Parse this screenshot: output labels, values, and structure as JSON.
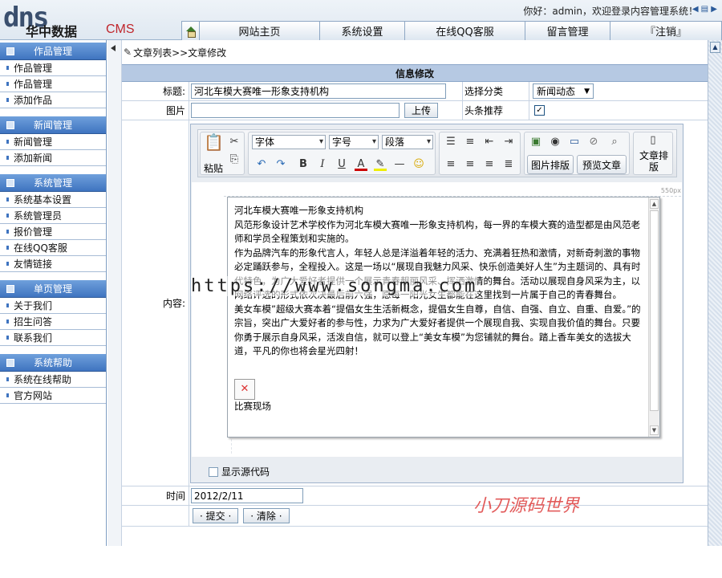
{
  "header": {
    "logo_main": "dns",
    "logo_cn": "华中数据",
    "logo_cms": "CMS",
    "welcome": "你好：admin，欢迎登录内容管理系统！",
    "nav": [
      "网站主页",
      "系统设置",
      "在线QQ客服",
      "留言管理",
      "『注销』"
    ]
  },
  "sidebar": {
    "groups": [
      {
        "title": "作品管理",
        "items": [
          "作品管理",
          "作品管理",
          "添加作品"
        ]
      },
      {
        "title": "新闻管理",
        "items": [
          "新闻管理",
          "添加新闻"
        ]
      },
      {
        "title": "系统管理",
        "items": [
          "系统基本设置",
          "系统管理员",
          "报价管理",
          "在线QQ客服",
          "友情链接"
        ]
      },
      {
        "title": "单页管理",
        "items": [
          "关于我们",
          "招生问答",
          "联系我们"
        ]
      },
      {
        "title": "系统帮助",
        "items": [
          "系统在线帮助",
          "官方网站"
        ]
      }
    ]
  },
  "breadcrumb": "文章列表>>文章修改",
  "form": {
    "title": "信息修改",
    "title_label": "标题:",
    "title_value": "河北车模大赛唯一形象支持机构",
    "category_label": "选择分类",
    "category_value": "新闻动态",
    "image_label": "图片",
    "upload_label": "上传",
    "headline_label": "头条推荐",
    "content_label": "内容:",
    "time_label": "时间",
    "time_value": "2012/2/11",
    "submit_label": "· 提交 ·",
    "clear_label": "· 清除 ·"
  },
  "editor": {
    "paste_label": "粘贴",
    "font_label": "字体",
    "size_label": "字号",
    "para_label": "段落",
    "image_layout_label": "图片排版",
    "preview_label": "预览文章",
    "doc_layout_label": "文章排版",
    "ruler_label": "550px",
    "show_source_label": "显示源代码",
    "content": {
      "title": "河北车模大赛唯一形象支持机构",
      "p1": "风范形象设计艺术学校作为河北车模大赛唯一形象支持机构，每一界的车模大赛的造型都是由风范老师和学员全程策划和实施的。",
      "p2": "作为品牌汽车的形象代言人，年轻人总是洋溢着年轻的活力、充满着狂热和激情，对新奇刺激的事物必定踊跃参与，全程投入。这是一场以“展现自我魅力风采、快乐创造美好人生”为主题词的、具有时代特色，为广大爱好者提供一个展示青春靓丽风采、挥洒激情的舞台。活动以展现自身风采为主，以网络评选的形式依次决最后前六强，愿每一阳光女生都能在这里找到一片属于自己的青春舞台。",
      "p3": "美女车模”超级大赛本着“提倡女生生活新概念，提倡女生自尊，自信、自强、自立、自重、自爱。”的宗旨，突出广大爱好者的参与性，力求为广大爱好者提供一个展现自我、实现自我价值的舞台。只要你勇于展示自身风采，活泼自信，就可以登上“美女车模”为您铺就的舞台。踏上香车美女的选拔大道，平凡的你也将会星光四射！",
      "caption": "比赛现场"
    }
  },
  "watermarks": {
    "url": "https://www.songma.com",
    "brand": "小刀源码世界"
  }
}
